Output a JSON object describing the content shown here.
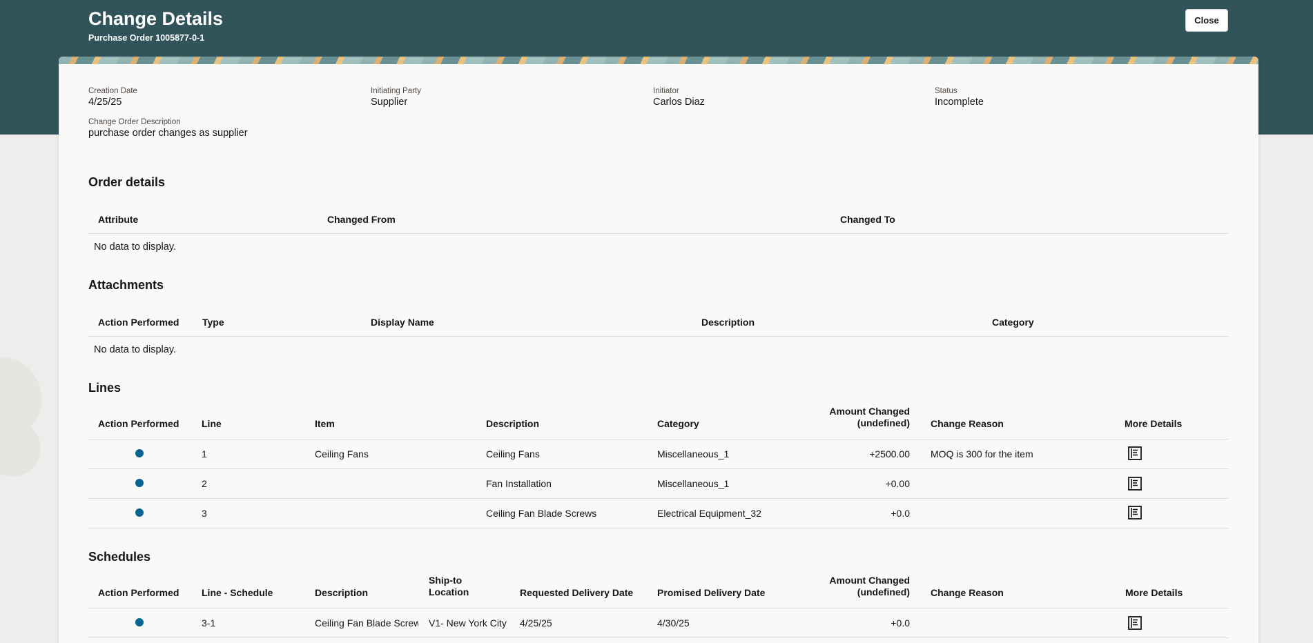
{
  "header": {
    "title": "Change Details",
    "subtitle": "Purchase Order 1005877-0-1",
    "close_label": "Close"
  },
  "summary": {
    "creation_date_label": "Creation Date",
    "creation_date": "4/25/25",
    "initiating_party_label": "Initiating Party",
    "initiating_party": "Supplier",
    "initiator_label": "Initiator",
    "initiator": "Carlos Diaz",
    "status_label": "Status",
    "status": "Incomplete",
    "description_label": "Change Order Description",
    "description": "purchase order changes as supplier"
  },
  "order_details": {
    "title": "Order details",
    "columns": [
      "Attribute",
      "Changed From",
      "Changed To"
    ],
    "empty": "No data to display."
  },
  "attachments": {
    "title": "Attachments",
    "columns": [
      "Action Performed",
      "Type",
      "Display Name",
      "Description",
      "Category"
    ],
    "empty": "No data to display."
  },
  "lines": {
    "title": "Lines",
    "columns": {
      "action": "Action Performed",
      "line": "Line",
      "item": "Item",
      "description": "Description",
      "category": "Category",
      "amount_1": "Amount Changed",
      "amount_2": "(undefined)",
      "reason": "Change Reason",
      "more": "More Details"
    },
    "rows": [
      {
        "line": "1",
        "item": "Ceiling Fans",
        "description": "Ceiling Fans",
        "category": "Miscellaneous_1",
        "amount": "+2500.00",
        "reason": "MOQ is 300 for the item"
      },
      {
        "line": "2",
        "item": "",
        "description": "Fan Installation",
        "category": "Miscellaneous_1",
        "amount": "+0.00",
        "reason": ""
      },
      {
        "line": "3",
        "item": "",
        "description": "Ceiling Fan Blade Screws",
        "category": "Electrical Equipment_32",
        "amount": "+0.0",
        "reason": ""
      }
    ]
  },
  "schedules": {
    "title": "Schedules",
    "columns": {
      "action": "Action Performed",
      "line_schedule": "Line - Schedule",
      "description": "Description",
      "ship_to_1": "Ship-to",
      "ship_to_2": "Location",
      "requested": "Requested Delivery Date",
      "promised": "Promised Delivery Date",
      "amount_1": "Amount Changed",
      "amount_2": "(undefined)",
      "reason": "Change Reason",
      "more": "More Details"
    },
    "rows": [
      {
        "line_schedule": "3-1",
        "description": "Ceiling Fan Blade Screws",
        "ship_to": "V1- New York City",
        "requested": "4/25/25",
        "promised": "4/30/25",
        "amount": "+0.0",
        "reason": ""
      }
    ]
  },
  "colors": {
    "header_bg": "#31535a",
    "action_dot": "#06648e",
    "card_bg": "#fbf9f8"
  },
  "icons": {
    "action_performed": "changed-dot-icon",
    "more_details": "details-document-icon"
  }
}
